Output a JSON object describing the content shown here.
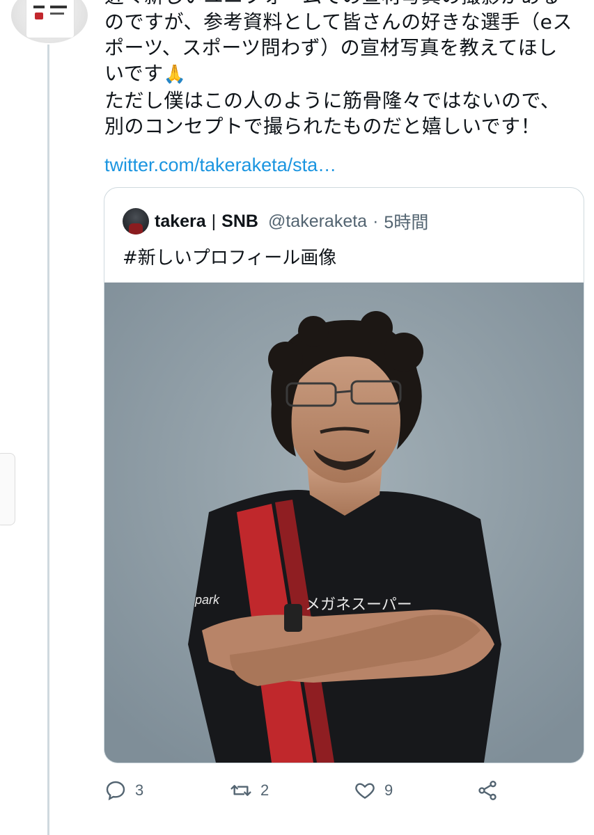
{
  "tweet": {
    "lines": [
      "近々新しいユニフォームでの宣材写真の撮影がある",
      "のですが、参考資料として皆さんの好きな選手（eス",
      "ポーツ、スポーツ問わず）の宣材写真を教えてほし",
      "いです",
      "ただし僕はこの人のように筋骨隆々ではないので、",
      "別のコンセプトで撮られたものだと嬉しいです！"
    ],
    "emoji": "🙏",
    "link": "twitter.com/takeraketa/sta…"
  },
  "quote": {
    "name": "takera",
    "separator": "|",
    "team": "SNB",
    "handle": "@takeraketa",
    "dot": "·",
    "time": "5時間",
    "text": "#新しいプロフィール画像",
    "jersey_text": "メガネスーパー",
    "sponsor_text": "park"
  },
  "actions": {
    "reply_count": "3",
    "retweet_count": "2",
    "like_count": "9"
  },
  "colors": {
    "link": "#1b95e0",
    "muted": "#536471",
    "border": "#cfd9de",
    "jersey_red": "#c0282c"
  }
}
